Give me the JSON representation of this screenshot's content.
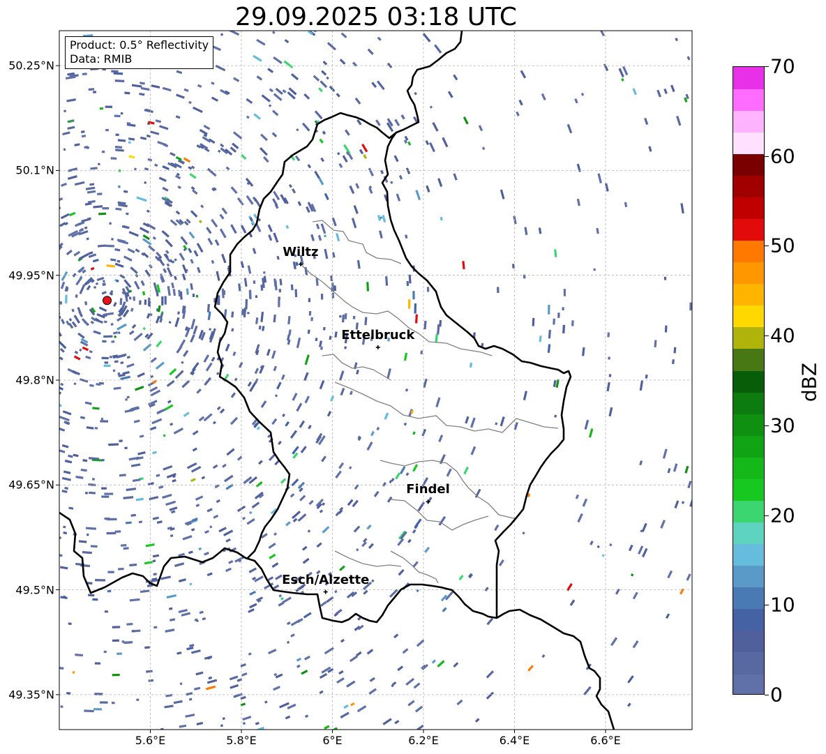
{
  "title": "29.09.2025 03:18 UTC",
  "info": {
    "product": "Product: 0.5° Reflectivity",
    "source": "Data: RMIB"
  },
  "map": {
    "lon_range": [
      5.4,
      6.79
    ],
    "lat_range": [
      49.3,
      50.3
    ],
    "radar_site": {
      "lon": 5.505,
      "lat": 49.914,
      "color": "#e8141c"
    },
    "border_color": "#000000",
    "canton_color": "#808080"
  },
  "axes": {
    "lat_ticks": [
      {
        "value": 50.25,
        "label": "50.25°N"
      },
      {
        "value": 50.1,
        "label": "50.1°N"
      },
      {
        "value": 49.95,
        "label": "49.95°N"
      },
      {
        "value": 49.8,
        "label": "49.8°N"
      },
      {
        "value": 49.65,
        "label": "49.65°N"
      },
      {
        "value": 49.5,
        "label": "49.5°N"
      },
      {
        "value": 49.35,
        "label": "49.35°N"
      }
    ],
    "lon_ticks": [
      {
        "value": 5.6,
        "label": "5.6°E"
      },
      {
        "value": 5.8,
        "label": "5.8°E"
      },
      {
        "value": 6.0,
        "label": "6°E"
      },
      {
        "value": 6.2,
        "label": "6.2°E"
      },
      {
        "value": 6.4,
        "label": "6.4°E"
      },
      {
        "value": 6.6,
        "label": "6.6°E"
      }
    ]
  },
  "cities": [
    {
      "name": "Wiltz",
      "lon": 5.93,
      "lat": 49.966
    },
    {
      "name": "Ettelbruck",
      "lon": 6.1,
      "lat": 49.847
    },
    {
      "name": "Findel",
      "lon": 6.21,
      "lat": 49.626
    },
    {
      "name": "Esch/Alzette",
      "lon": 5.985,
      "lat": 49.497
    }
  ],
  "colorbar": {
    "label": "dBZ",
    "min": 0,
    "max": 70,
    "ticks": [
      {
        "value": 0,
        "label": "0"
      },
      {
        "value": 10,
        "label": "10"
      },
      {
        "value": 20,
        "label": "20"
      },
      {
        "value": 30,
        "label": "30"
      },
      {
        "value": 40,
        "label": "40"
      },
      {
        "value": 50,
        "label": "50"
      },
      {
        "value": 60,
        "label": "60"
      },
      {
        "value": 70,
        "label": "70"
      }
    ],
    "colors": [
      "#6070a8",
      "#5868a0",
      "#50609c",
      "#4462a4",
      "#4a7ab4",
      "#5a9ac8",
      "#66bcdc",
      "#5ed4c0",
      "#3cd670",
      "#16c820",
      "#14b818",
      "#10a414",
      "#109010",
      "#0c7c10",
      "#085e08",
      "#487814",
      "#b0b40a",
      "#ffd800",
      "#ffb400",
      "#ff9800",
      "#ff7800",
      "#e20a0a",
      "#c00000",
      "#a00000",
      "#7a0000",
      "#ffe0ff",
      "#ffb4ff",
      "#ff6cff",
      "#e830e8"
    ]
  }
}
